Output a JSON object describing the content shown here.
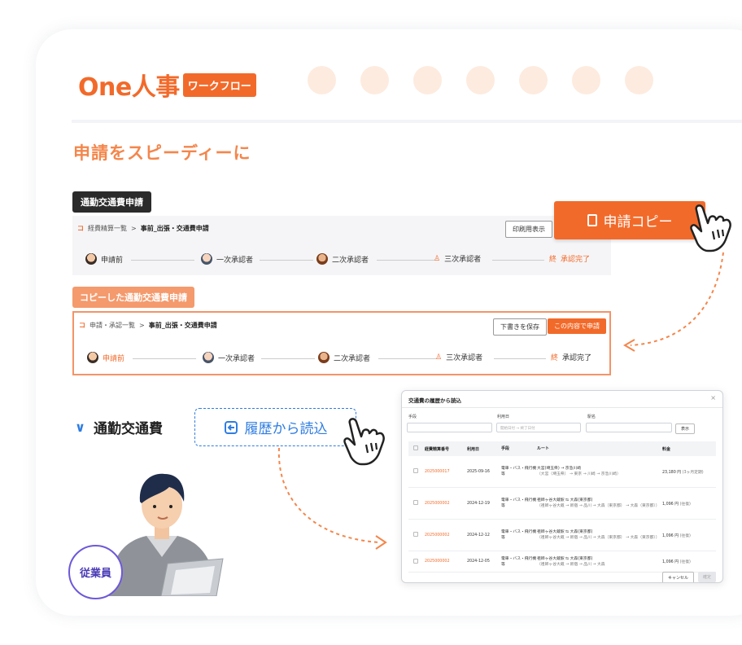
{
  "brand": {
    "name": "One人事",
    "badge": "ワークフロー"
  },
  "headline": "申請をスピーディーに",
  "original": {
    "tag": "通勤交通費申請",
    "breadcrumb": {
      "marker": "コ",
      "parent": "経費精算一覧",
      "sep": ">",
      "current": "事前_出張・交通費申請"
    },
    "print_button": "印刷用表示"
  },
  "copy_button": "申請コピー",
  "copied": {
    "tag": "コピーした通勤交通費申請",
    "breadcrumb": {
      "marker": "コ",
      "parent": "申請・承認一覧",
      "sep": ">",
      "current": "事前_出張・交通費申請"
    },
    "draft_button": "下書きを保存",
    "submit_button": "この内容で申請"
  },
  "flow": {
    "step1": "申請前",
    "step2": "一次承認者",
    "step3": "二次承認者",
    "step4": "三次承認者",
    "step5_icon": "終",
    "step5": "承認完了"
  },
  "section": {
    "chevron": "∨",
    "title": "通勤交通費",
    "history_button": "履歴から読込"
  },
  "modal": {
    "title": "交通費の履歴から読込",
    "close": "×",
    "labels": {
      "means": "手段",
      "date": "利用日",
      "station": "駅名"
    },
    "date_from": "開始日付",
    "date_to": "終了日付",
    "display_button": "表示",
    "columns": {
      "no": "経費精算番号",
      "date": "利用日",
      "means": "手段",
      "route": "ルート",
      "fee": "料金"
    },
    "rows": [
      {
        "no": "2025000017",
        "date": "2025-09-16",
        "means": "電車・バス・飛行機等",
        "route": "大宮(埼玉県) → 京急川崎",
        "sub": "（大宮（埼玉県） → 東京 → 川崎 → 京急川崎）",
        "fee": "23,180 円",
        "fee_note": "(3ヶ月定期)"
      },
      {
        "no": "2025000002",
        "date": "2024-12-19",
        "means": "電車・バス・飛行機等",
        "route": "祖師ヶ谷大蔵駅 ⇆ 大森(東京都)",
        "sub": "（祖師ヶ谷大蔵 → 新宿 → 品川 → 大森（東京都） → 大森（東京都））",
        "fee": "1,096 円",
        "fee_note": "(往復)"
      },
      {
        "no": "2025000002",
        "date": "2024-12-12",
        "means": "電車・バス・飛行機等",
        "route": "祖師ヶ谷大蔵駅 ⇆ 大森(東京都)",
        "sub": "（祖師ヶ谷大蔵 → 新宿 → 品川 → 大森（東京都） → 大森（東京都））",
        "fee": "1,096 円",
        "fee_note": "(往復)"
      },
      {
        "no": "2025000002",
        "date": "2024-12-05",
        "means": "電車・バス・飛行機等",
        "route": "祖師ヶ谷大蔵駅 ⇆ 大森(東京都)",
        "sub": "（祖師ヶ谷大蔵 → 新宿 → 品川 → 大森",
        "fee": "1,096 円",
        "fee_note": "(往復)"
      }
    ],
    "cancel_button": "キャンセル",
    "confirm_button": "確定"
  },
  "employee_badge": "従業員",
  "colors": {
    "accent": "#f26a2a",
    "blue": "#2f7de1",
    "purple": "#6e58d9"
  }
}
